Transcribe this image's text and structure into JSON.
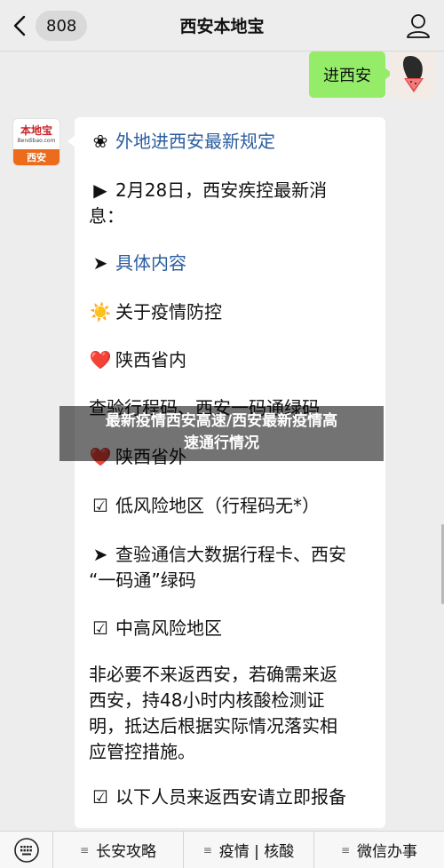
{
  "header": {
    "badge_count": "808",
    "title": "西安本地宝"
  },
  "my_message": {
    "text": "进西安"
  },
  "bot_avatar": {
    "logo_main": "本地宝",
    "logo_url": "Bendibao.com",
    "logo_city": "西安"
  },
  "bot_message": {
    "lines": [
      {
        "icon": "❀",
        "text": "外地进西安最新规定"
      },
      {
        "icon": "▶",
        "text": "2月28日，西安疾控最新消"
      },
      {
        "icon": "",
        "text": "息："
      },
      {
        "icon": "➤",
        "text": "具体内容"
      },
      {
        "icon": "☀️",
        "text": "关于疫情防控"
      },
      {
        "icon": "❤️",
        "text": "陕西省内"
      },
      {
        "icon": "",
        "text": "查验行程码、西安一码通绿码"
      },
      {
        "icon": "❤️",
        "text": "陕西省外"
      },
      {
        "icon": "☑",
        "text": "低风险地区（行程码无*）"
      },
      {
        "icon": "➤",
        "text": "查验通信大数据行程卡、西安"
      },
      {
        "icon": "",
        "text": "“一码通”绿码"
      },
      {
        "icon": "☑",
        "text": "中高风险地区"
      },
      {
        "icon": "",
        "text": "非必要不来返西安，若确需来返"
      },
      {
        "icon": "",
        "text": "西安，持48小时内核酸检测证"
      },
      {
        "icon": "",
        "text": "明，抵达后根据实际情况落实相"
      },
      {
        "icon": "",
        "text": "应管控措施。"
      },
      {
        "icon": "☑",
        "text": "以下人员来返西安请立即报备"
      }
    ]
  },
  "overlay": {
    "line1": "最新疫情西安高速/西安最新疫情高",
    "line2": "速通行情况"
  },
  "bottom_menu": {
    "items": [
      "长安攻略",
      "疫情 | 核酸",
      "微信办事"
    ]
  }
}
